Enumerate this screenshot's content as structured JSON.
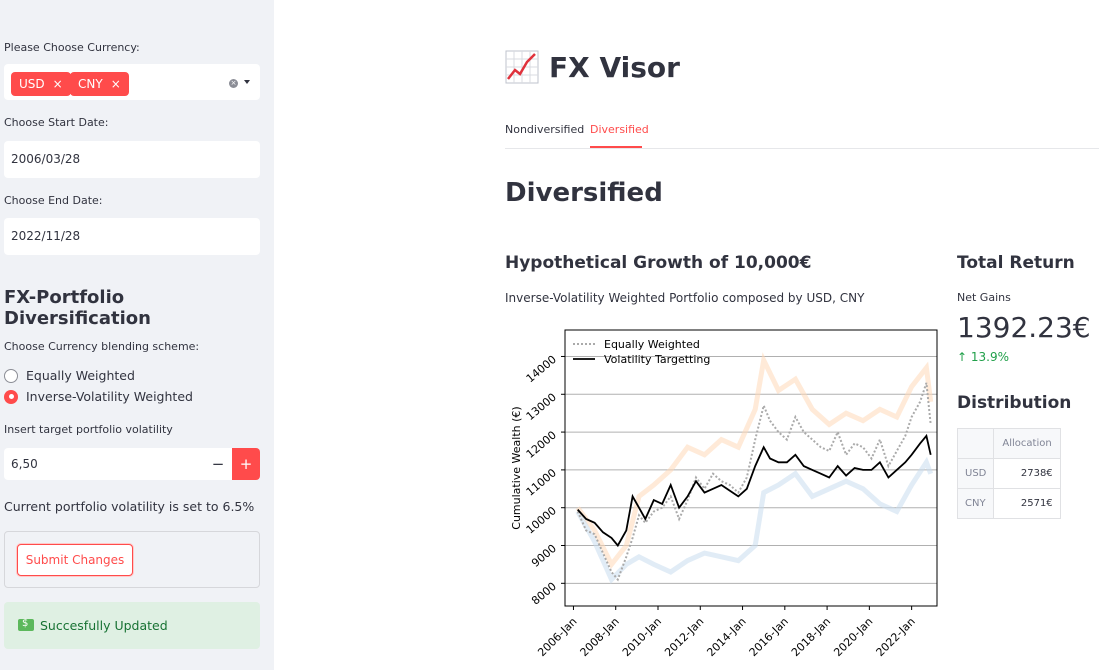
{
  "sidebar": {
    "currency_label": "Please Choose Currency:",
    "selected_currencies": [
      "USD",
      "CNY"
    ],
    "start_date_label": "Choose Start Date:",
    "start_date": "2006/03/28",
    "end_date_label": "Choose End Date:",
    "end_date": "2022/11/28",
    "section_title": "FX-Portfolio Diversification",
    "scheme_label": "Choose Currency blending scheme:",
    "scheme_options": [
      "Equally Weighted",
      "Inverse-Volatility Weighted"
    ],
    "scheme_selected": "Inverse-Volatility Weighted",
    "volatility_label": "Insert target portfolio volatility",
    "volatility_value": "6,50",
    "minus_label": "−",
    "plus_label": "+",
    "current_volatility_text": "Current portfolio volatility is set to 6.5%",
    "submit_label": "Submit Changes",
    "success_text": "Succesfully Updated",
    "chip_remove": "×"
  },
  "main": {
    "app_title": "FX Visor",
    "tabs": [
      "Nondiversified",
      "Diversified"
    ],
    "active_tab": "Diversified",
    "section_heading": "Diversified",
    "growth_heading": "Hypothetical Growth of 10,000€",
    "growth_subtitle": "Inverse-Volatility Weighted Portfolio composed by USD, CNY",
    "total_return_heading": "Total Return",
    "net_gains_label": "Net Gains",
    "net_gains_value": "1392.23€",
    "net_gains_delta": "↑ 13.9%",
    "distribution_heading": "Distribution",
    "distribution": {
      "header": "Allocation",
      "rows": [
        {
          "currency": "USD",
          "allocation": "2738€"
        },
        {
          "currency": "CNY",
          "allocation": "2571€"
        }
      ]
    }
  },
  "colors": {
    "accent": "#ff4b4b",
    "success_bg": "#dff0e3",
    "success_text": "#177233",
    "delta_green": "#21a04a",
    "orange_faint": "#ffd8b8",
    "blue_faint": "#c9dcef"
  },
  "chart_data": {
    "type": "line",
    "ylabel": "Cumulative Wealth (€)",
    "xlabel": "",
    "x_ticks": [
      "2006-Jan",
      "2008-Jan",
      "2010-Jan",
      "2012-Jan",
      "2014-Jan",
      "2016-Jan",
      "2018-Jan",
      "2020-Jan",
      "2022-Jan"
    ],
    "y_ticks": [
      8000,
      9000,
      10000,
      11000,
      12000,
      13000,
      14000
    ],
    "xlim": [
      2005.6,
      2023.2
    ],
    "ylim": [
      7400,
      14700
    ],
    "grid": "horizontal",
    "legend_position": "top-left",
    "series": [
      {
        "name": "Equally Weighted",
        "style": "dotted",
        "color": "#aaaaaa",
        "x": [
          2006.2,
          2006.6,
          2007.0,
          2007.4,
          2007.8,
          2008.1,
          2008.5,
          2008.8,
          2009.1,
          2009.4,
          2009.8,
          2010.2,
          2010.6,
          2011.0,
          2011.4,
          2011.8,
          2012.2,
          2012.6,
          2013.0,
          2013.4,
          2013.8,
          2014.2,
          2014.6,
          2015.0,
          2015.3,
          2015.7,
          2016.1,
          2016.5,
          2016.9,
          2017.3,
          2017.7,
          2018.1,
          2018.5,
          2018.9,
          2019.3,
          2019.7,
          2020.1,
          2020.5,
          2020.9,
          2021.3,
          2021.7,
          2022.0,
          2022.4,
          2022.7,
          2022.9
        ],
        "values": [
          9900,
          9400,
          9300,
          8800,
          8300,
          8100,
          8700,
          9200,
          9800,
          9600,
          9900,
          10000,
          10300,
          9700,
          10200,
          10800,
          10500,
          10900,
          10700,
          10600,
          10400,
          10800,
          11800,
          12700,
          12300,
          12000,
          11800,
          12400,
          12000,
          11800,
          11600,
          11500,
          12000,
          11400,
          11700,
          11600,
          11300,
          11800,
          11100,
          11500,
          11900,
          12400,
          12800,
          13300,
          12200
        ]
      },
      {
        "name": "Volatility Targetting",
        "style": "solid",
        "color": "#000000",
        "x": [
          2006.2,
          2006.6,
          2007.0,
          2007.4,
          2007.8,
          2008.1,
          2008.5,
          2008.8,
          2009.1,
          2009.4,
          2009.8,
          2010.2,
          2010.6,
          2011.0,
          2011.4,
          2011.8,
          2012.2,
          2012.6,
          2013.0,
          2013.4,
          2013.8,
          2014.2,
          2014.6,
          2015.0,
          2015.3,
          2015.7,
          2016.1,
          2016.5,
          2016.9,
          2017.3,
          2017.7,
          2018.1,
          2018.5,
          2018.9,
          2019.3,
          2019.7,
          2020.1,
          2020.5,
          2020.9,
          2021.3,
          2021.7,
          2022.0,
          2022.4,
          2022.7,
          2022.9
        ],
        "values": [
          9950,
          9700,
          9600,
          9350,
          9200,
          9000,
          9400,
          10300,
          10000,
          9700,
          10200,
          10100,
          10600,
          10000,
          10300,
          10700,
          10400,
          10500,
          10600,
          10450,
          10300,
          10500,
          11100,
          11600,
          11300,
          11200,
          11200,
          11400,
          11100,
          11000,
          10900,
          10800,
          11100,
          10850,
          11050,
          11000,
          11000,
          11200,
          10800,
          11000,
          11200,
          11400,
          11700,
          11900,
          11400
        ]
      },
      {
        "name": "",
        "style": "faint",
        "color": "#ffd8b8",
        "x": [
          2006.2,
          2007.0,
          2007.8,
          2008.5,
          2009.1,
          2009.8,
          2010.6,
          2011.4,
          2012.2,
          2013.0,
          2013.8,
          2014.6,
          2015.0,
          2015.7,
          2016.5,
          2017.3,
          2018.1,
          2018.9,
          2019.7,
          2020.5,
          2021.3,
          2022.0,
          2022.7,
          2022.9
        ],
        "values": [
          10000,
          9400,
          8500,
          9000,
          10300,
          10600,
          11000,
          11600,
          11400,
          11800,
          11600,
          12600,
          13900,
          13100,
          13400,
          12600,
          12200,
          12500,
          12300,
          12600,
          12400,
          13200,
          13700,
          12800
        ]
      },
      {
        "name": "",
        "style": "faint",
        "color": "#c9dcef",
        "x": [
          2006.2,
          2007.0,
          2007.8,
          2008.5,
          2009.1,
          2009.8,
          2010.6,
          2011.4,
          2012.2,
          2013.0,
          2013.8,
          2014.6,
          2015.0,
          2015.7,
          2016.5,
          2017.3,
          2018.1,
          2018.9,
          2019.7,
          2020.5,
          2021.3,
          2022.0,
          2022.7,
          2022.9
        ],
        "values": [
          9900,
          9100,
          8100,
          8500,
          8700,
          8500,
          8300,
          8600,
          8800,
          8700,
          8600,
          9000,
          10400,
          10600,
          10900,
          10300,
          10500,
          10700,
          10500,
          10100,
          9900,
          10600,
          11200,
          10900
        ]
      }
    ]
  }
}
